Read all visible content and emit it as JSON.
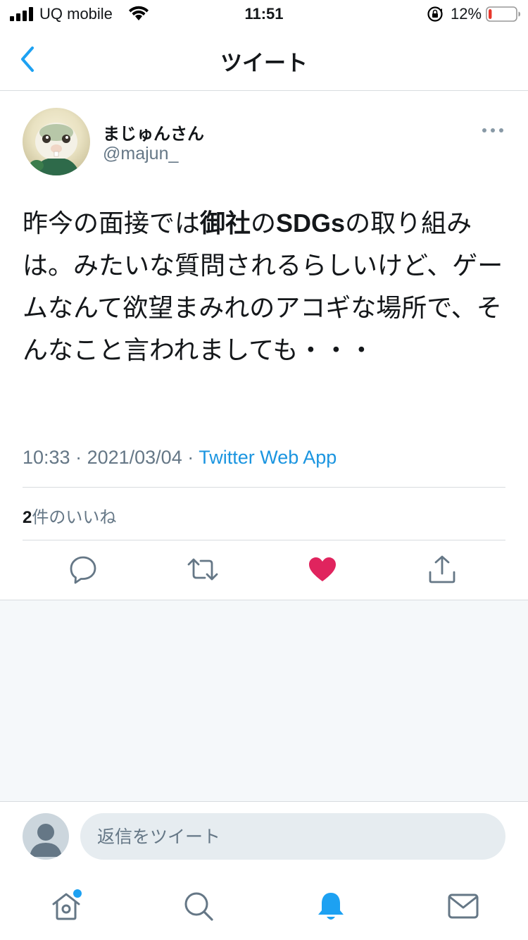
{
  "status_bar": {
    "carrier": "UQ mobile",
    "time": "11:51",
    "battery_percent": "12%",
    "battery_level": 0.12
  },
  "nav": {
    "title": "ツイート",
    "back_icon": "chevron-left-icon"
  },
  "tweet": {
    "display_name": "まじゅんさん",
    "handle": "@majun_",
    "text_parts": {
      "p1": "昨今の面接では",
      "p2": "御社",
      "p3": "の",
      "p4": "SDGs",
      "p5": "の取り組みは。みたいな質問されるらしいけど、ゲームなんて欲望まみれのアコギな場所で、そんなこと言われましても・・・"
    },
    "time": "10:33",
    "separator": " · ",
    "date": "2021/03/04",
    "source": "Twitter Web App",
    "likes_count": "2",
    "likes_label": "件のいいね",
    "liked": true
  },
  "actions": [
    "reply-icon",
    "retweet-icon",
    "like-icon",
    "share-icon"
  ],
  "reply": {
    "placeholder": "返信をツイート"
  },
  "tab_bar": [
    "home-icon",
    "search-icon",
    "notifications-icon",
    "messages-icon"
  ],
  "colors": {
    "accent": "#1da1f2",
    "like": "#e0245e",
    "secondary_text": "#657786",
    "divider": "#d8dcdf"
  }
}
